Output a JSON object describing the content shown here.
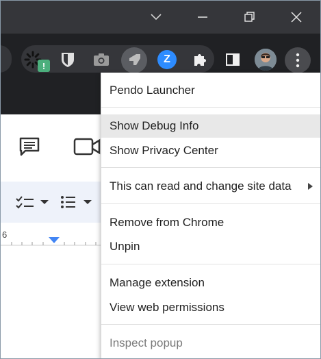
{
  "window": {
    "controls": [
      "chevron-down-icon",
      "minimize-icon",
      "restore-icon",
      "close-icon"
    ]
  },
  "toolbar": {
    "extensions": [
      "loading-extension-icon",
      "shield-extension-icon",
      "camera-extension-icon",
      "pendo-launcher-icon",
      "zoom-extension-icon",
      "puzzle-icon"
    ],
    "badge_text": "!",
    "zoom_letter": "Z"
  },
  "menu": {
    "title": "Pendo Launcher",
    "items": [
      "Show Debug Info",
      "Show Privacy Center",
      "This can read and change site data",
      "Remove from Chrome",
      "Unpin",
      "Manage extension",
      "View web permissions",
      "Inspect popup"
    ]
  },
  "docs": {
    "ruler_number": "6"
  }
}
